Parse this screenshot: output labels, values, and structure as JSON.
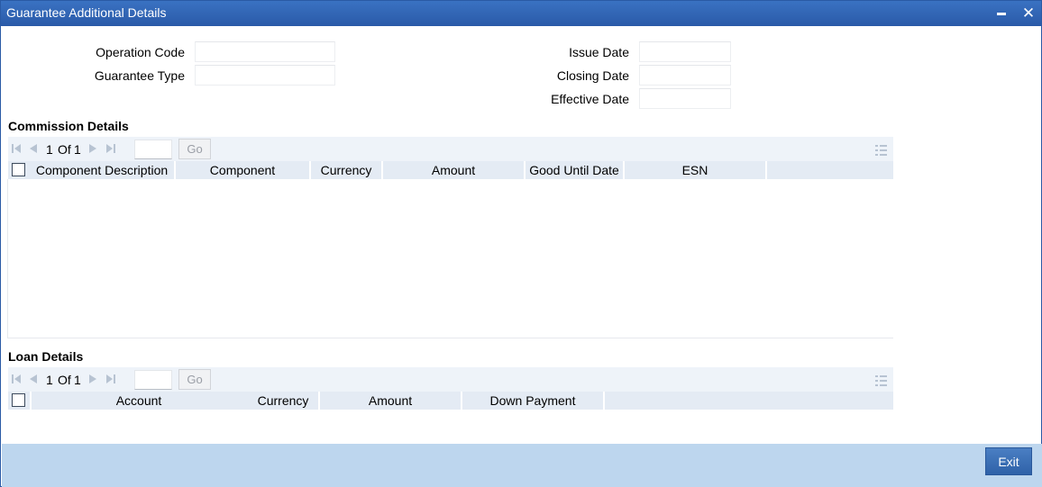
{
  "window": {
    "title": "Guarantee Additional Details",
    "minimize_icon": "minimize-icon",
    "close_icon": "close-icon"
  },
  "form": {
    "operation_code_label": "Operation Code",
    "operation_code_value": "",
    "guarantee_type_label": "Guarantee Type",
    "guarantee_type_value": "",
    "issue_date_label": "Issue Date",
    "issue_date_value": "",
    "closing_date_label": "Closing Date",
    "closing_date_value": "",
    "effective_date_label": "Effective Date",
    "effective_date_value": ""
  },
  "commission": {
    "title": "Commission Details",
    "pager": {
      "current": "1",
      "of_label": "Of",
      "total": "1",
      "go_label": "Go",
      "page_input": ""
    },
    "columns": [
      "Component Description",
      "Component",
      "Currency",
      "Amount",
      "Good Until Date",
      "ESN"
    ],
    "rows": []
  },
  "loan": {
    "title": "Loan Details",
    "pager": {
      "current": "1",
      "of_label": "Of",
      "total": "1",
      "go_label": "Go",
      "page_input": ""
    },
    "columns": [
      "Account",
      "Currency",
      "Amount",
      "Down Payment"
    ],
    "rows": []
  },
  "footer": {
    "exit_label": "Exit"
  },
  "colors": {
    "title_bar": "#2f65b4",
    "footer": "#bdd6ee",
    "grid_header": "#e4ebf4",
    "pager_bg": "#eef3f9"
  }
}
